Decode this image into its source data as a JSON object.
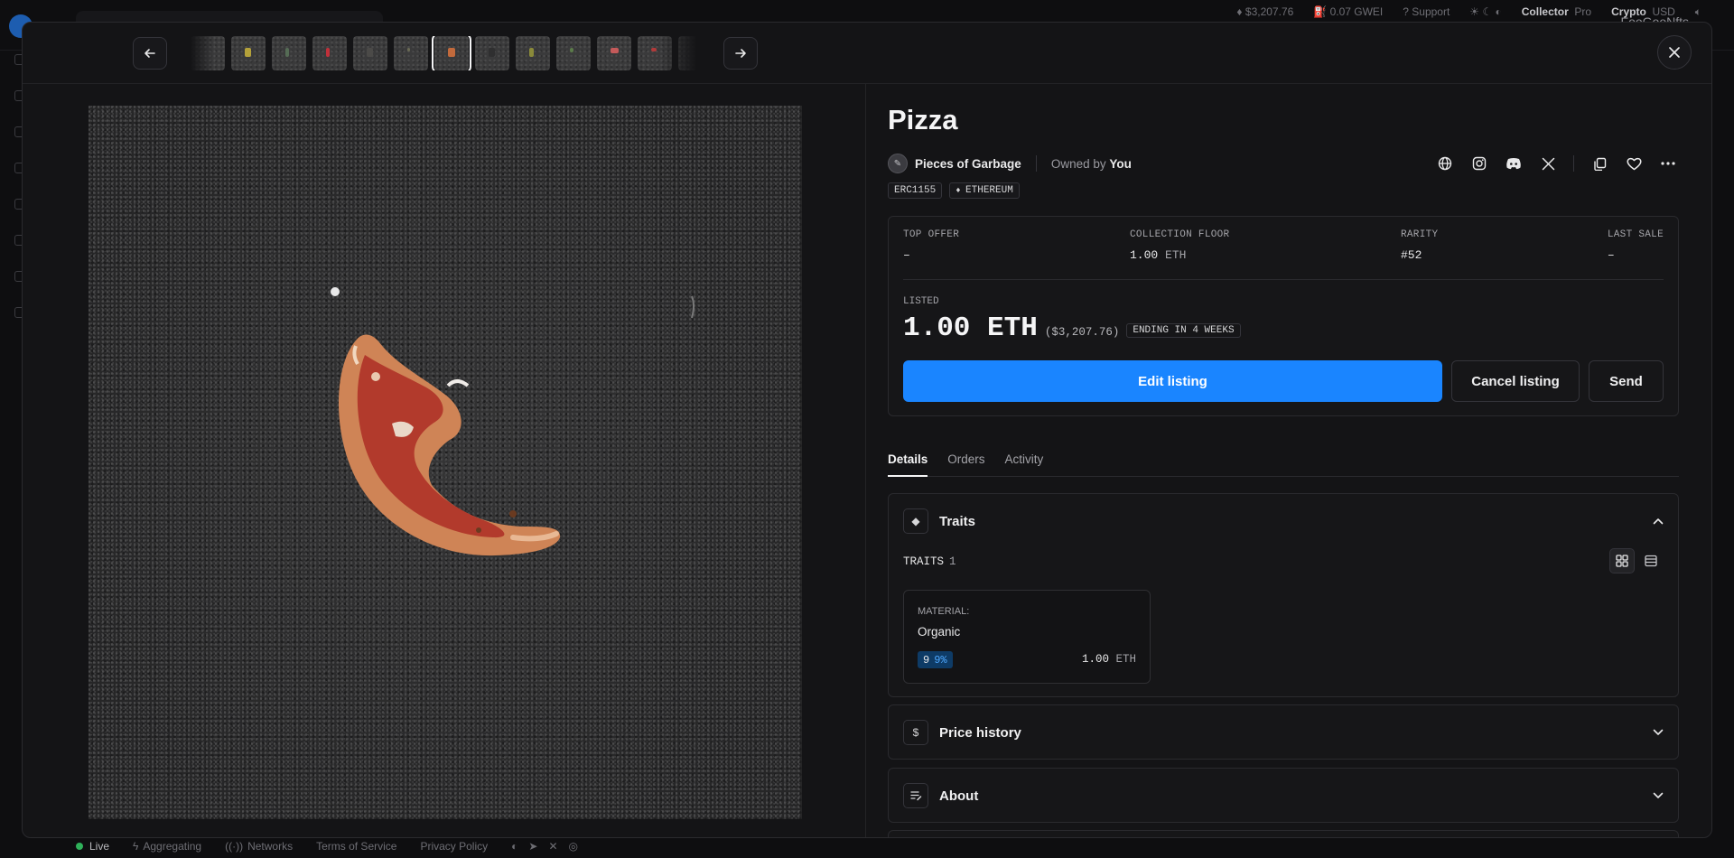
{
  "background": {
    "user_label": "FooGooNfts",
    "footer": {
      "live": "Live",
      "aggregating": "Aggregating",
      "networks": "Networks",
      "terms": "Terms of Service",
      "privacy": "Privacy Policy",
      "eth_price": "$3,207.76",
      "gas": "0.07 GWEI",
      "support": "Support",
      "mode_collector": "Collector",
      "mode_pro": "Pro",
      "currency_crypto": "Crypto",
      "currency_usd": "USD"
    }
  },
  "item": {
    "title": "Pizza",
    "collection": "Pieces of Garbage",
    "owned_prefix": "Owned by",
    "owner": "You",
    "tags": [
      "ERC1155",
      "ETHEREUM"
    ]
  },
  "stats": {
    "top_offer": {
      "label": "TOP OFFER",
      "value": "–"
    },
    "floor": {
      "label": "COLLECTION FLOOR",
      "value": "1.00",
      "unit": "ETH"
    },
    "rarity": {
      "label": "RARITY",
      "value": "#52"
    },
    "last_sale": {
      "label": "LAST SALE",
      "value": "–"
    }
  },
  "listing": {
    "label": "LISTED",
    "price": "1.00 ETH",
    "usd": "($3,207.76)",
    "ending": "ENDING IN 4 WEEKS",
    "edit": "Edit listing",
    "cancel": "Cancel listing",
    "send": "Send"
  },
  "tabs": [
    "Details",
    "Orders",
    "Activity"
  ],
  "traits": {
    "title": "Traits",
    "sub_label": "TRAITS",
    "count": "1",
    "items": [
      {
        "type": "MATERIAL:",
        "value": "Organic",
        "count": "9",
        "pct": "9%",
        "price": "1.00",
        "unit": "ETH"
      }
    ]
  },
  "panels": {
    "price_history": "Price history",
    "about": "About"
  },
  "colors": {
    "accent": "#1a85ff",
    "rarity_bg": "#0e3b66",
    "live": "#2fb15a"
  }
}
